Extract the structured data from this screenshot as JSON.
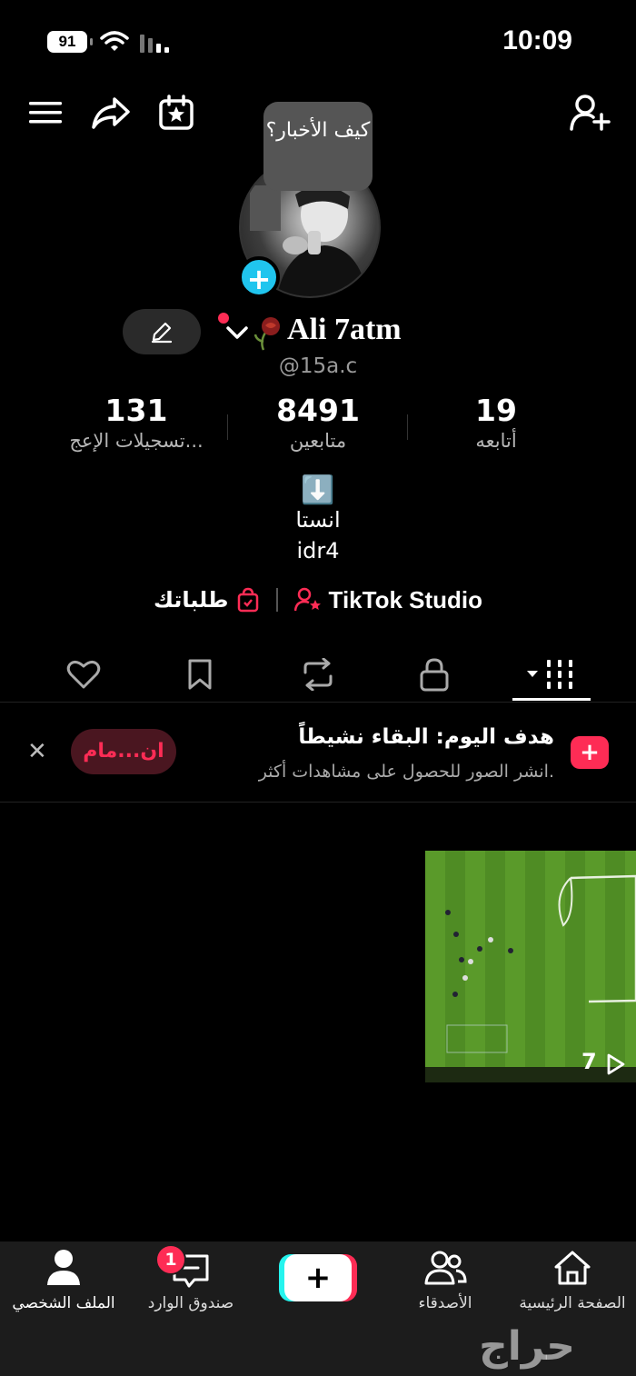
{
  "status_bar": {
    "time": "10:09",
    "battery": "91"
  },
  "avatar": {
    "bubble_text": "كيف الأخبار؟",
    "add_badge": "+"
  },
  "profile": {
    "display_name": "Ali 7atm",
    "username": "@15a.c"
  },
  "stats": [
    {
      "value": "131",
      "label": "تسجيلات الإعج..."
    },
    {
      "value": "8491",
      "label": "متابعين"
    },
    {
      "value": "19",
      "label": "أتابعه"
    }
  ],
  "bio": {
    "emoji": "⬇️",
    "line1": "انستا",
    "line2": "idr4"
  },
  "links": {
    "orders": "طلباتك",
    "studio": "TikTok Studio"
  },
  "goal": {
    "title": "هدف اليوم: البقاء نشيطاً",
    "subtitle": "انشر الصور للحصول على مشاهدات أكثر.",
    "button": "ان...مام",
    "icon": "+"
  },
  "video": {
    "play_count": "7"
  },
  "nav": {
    "home": "الصفحة الرئيسية",
    "friends": "الأصدقاء",
    "create": "+",
    "inbox": "صندوق الوارد",
    "inbox_badge": "1",
    "profile": "الملف الشخصي"
  },
  "watermark": "حراج",
  "colors": {
    "accent": "#fe2c55",
    "cyan": "#25f4ee",
    "badge_blue": "#20c5ee"
  }
}
